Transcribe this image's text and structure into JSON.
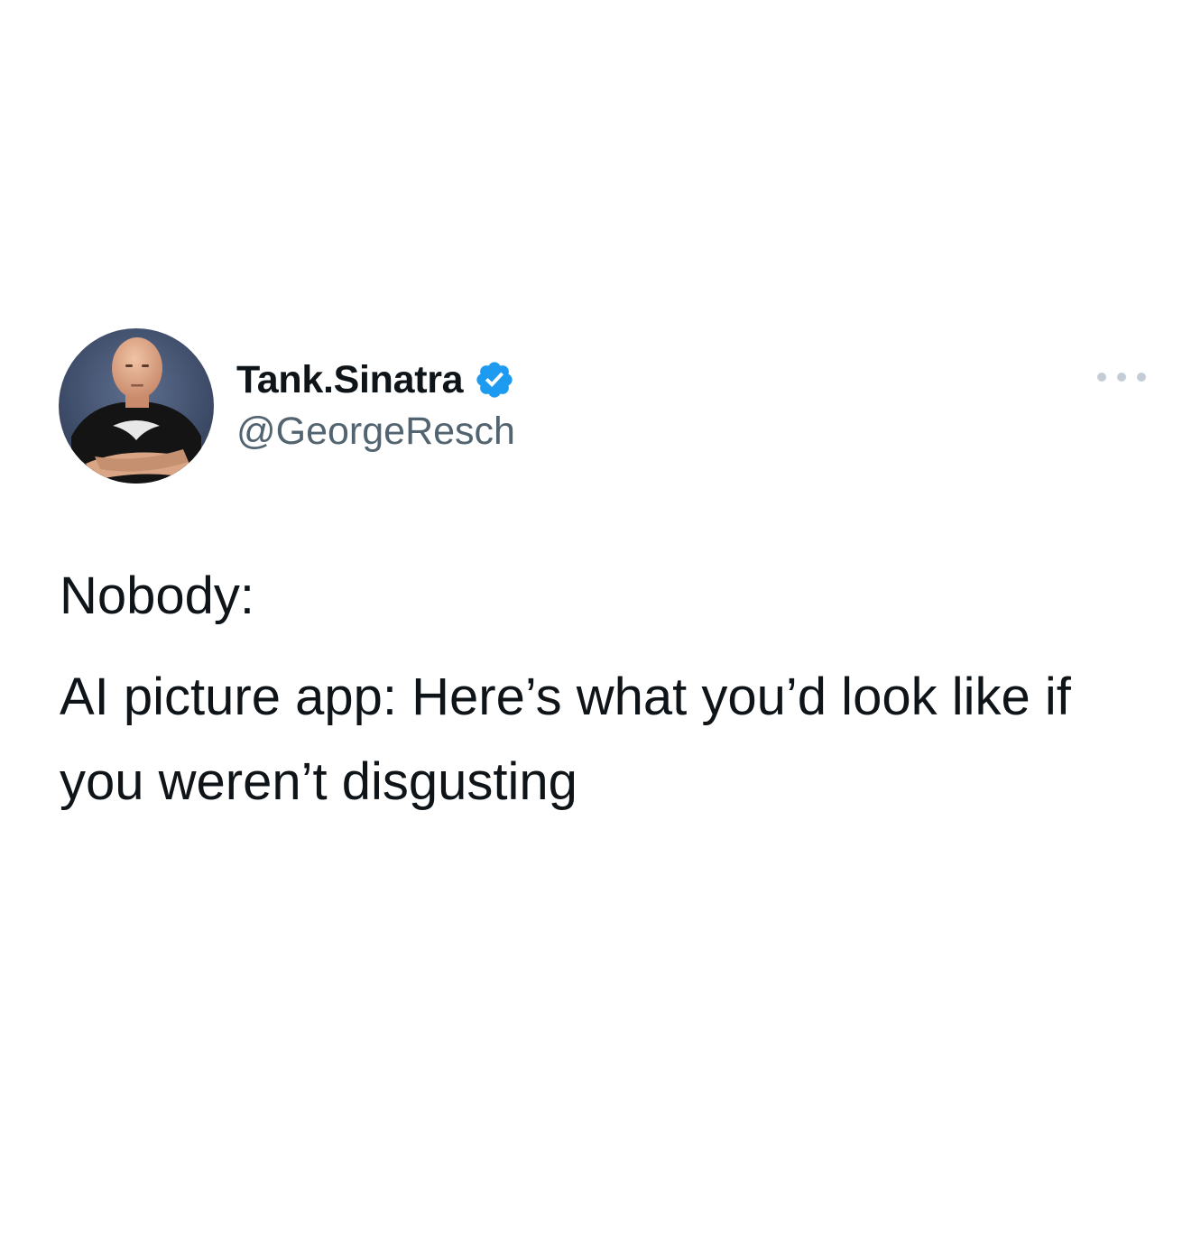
{
  "tweet": {
    "author": {
      "display_name": "Tank.Sinatra",
      "handle": "@GeorgeResch",
      "verified": true,
      "avatar_icon": "profile-photo"
    },
    "more_icon": "ellipsis-icon",
    "lines": [
      "Nobody:",
      "AI picture app: Here’s what you’d look like if you weren’t disgusting"
    ]
  },
  "colors": {
    "text_primary": "#0f1419",
    "text_secondary": "#536471",
    "verified_blue": "#1d9bf0",
    "more_dots": "#c4cdd5",
    "background": "#ffffff"
  }
}
